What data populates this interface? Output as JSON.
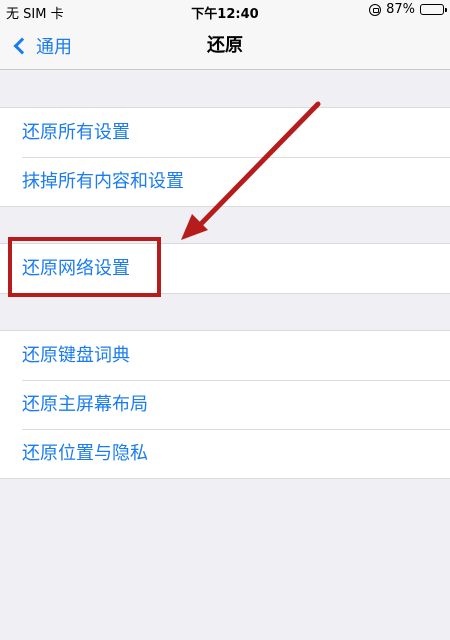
{
  "status_bar": {
    "carrier": "无 SIM 卡",
    "time": "下午12:40",
    "battery_percent": "87%",
    "battery_level": 0.87
  },
  "nav": {
    "back_label": "通用",
    "title": "还原"
  },
  "groups": [
    {
      "items": [
        "还原所有设置",
        "抹掉所有内容和设置"
      ]
    },
    {
      "items": [
        "还原网络设置"
      ]
    },
    {
      "items": [
        "还原键盘词典",
        "还原主屏幕布局",
        "还原位置与隐私"
      ]
    }
  ],
  "colors": {
    "link": "#1a7cf0",
    "annotation": "#b71c1c",
    "background": "#efeff4"
  }
}
